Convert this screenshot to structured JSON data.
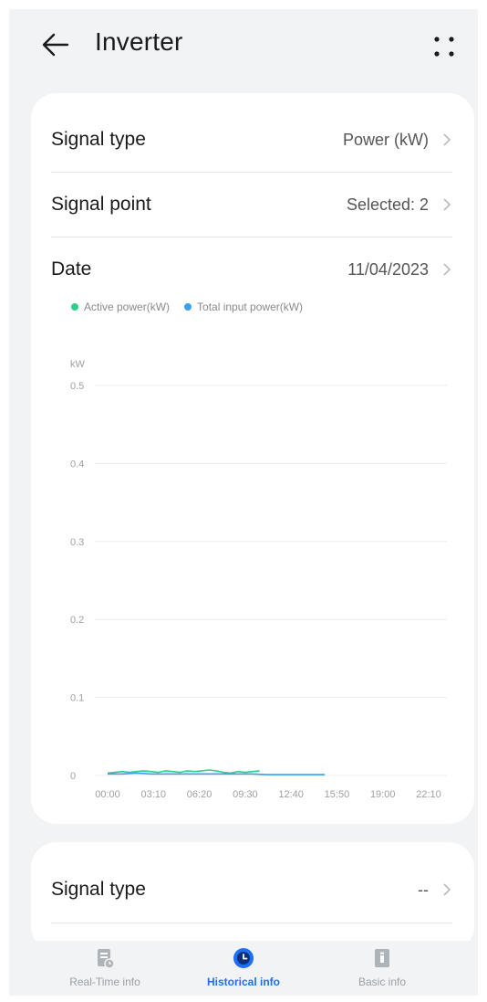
{
  "header": {
    "title": "Inverter",
    "back_icon": "arrow-left-icon",
    "more_icon": "more-dots-icon"
  },
  "settings": [
    {
      "label": "Signal type",
      "value": "Power (kW)"
    },
    {
      "label": "Signal point",
      "value": "Selected: 2"
    },
    {
      "label": "Date",
      "value": "11/04/2023"
    }
  ],
  "chart_data": {
    "type": "line",
    "ylabel": "kW",
    "ylim": [
      0,
      0.5
    ],
    "yticks": [
      "0.5",
      "0.4",
      "0.3",
      "0.2",
      "0.1",
      "0"
    ],
    "x": [
      "00:00",
      "03:10",
      "06:20",
      "09:30",
      "12:40",
      "15:50",
      "19:00",
      "22:10"
    ],
    "legend": [
      {
        "name": "Active power(kW)",
        "color": "#2ecf8b"
      },
      {
        "name": "Total input power(kW)",
        "color": "#3aa0f0"
      }
    ],
    "series": [
      {
        "name": "Active power(kW)",
        "color": "#2ecf8b",
        "points": [
          [
            0.0,
            0.003
          ],
          [
            0.5,
            0.004
          ],
          [
            1.0,
            0.005
          ],
          [
            1.5,
            0.004
          ],
          [
            2.0,
            0.005
          ],
          [
            2.5,
            0.006
          ],
          [
            3.0,
            0.005
          ],
          [
            3.5,
            0.004
          ],
          [
            4.0,
            0.006
          ],
          [
            4.5,
            0.005
          ],
          [
            5.0,
            0.004
          ],
          [
            5.5,
            0.006
          ],
          [
            6.0,
            0.005
          ],
          [
            6.5,
            0.006
          ],
          [
            7.0,
            0.007
          ],
          [
            7.5,
            0.006
          ],
          [
            8.0,
            0.004
          ],
          [
            8.5,
            0.003
          ],
          [
            9.0,
            0.005
          ],
          [
            9.5,
            0.004
          ],
          [
            10.0,
            0.005
          ],
          [
            10.5,
            0.006
          ]
        ]
      },
      {
        "name": "Total input power(kW)",
        "color": "#3aa0f0",
        "points": [
          [
            0.0,
            0.002
          ],
          [
            1.0,
            0.002
          ],
          [
            2.0,
            0.003
          ],
          [
            3.0,
            0.002
          ],
          [
            4.0,
            0.002
          ],
          [
            5.0,
            0.002
          ],
          [
            6.0,
            0.002
          ],
          [
            7.0,
            0.002
          ],
          [
            8.0,
            0.002
          ],
          [
            9.0,
            0.002
          ],
          [
            10.0,
            0.002
          ],
          [
            11.0,
            0.001
          ],
          [
            12.0,
            0.001
          ],
          [
            13.0,
            0.001
          ],
          [
            14.0,
            0.001
          ],
          [
            15.0,
            0.001
          ]
        ]
      }
    ]
  },
  "second_card": {
    "label": "Signal type",
    "value": "--"
  },
  "nav": [
    {
      "label": "Real-Time info",
      "icon": "realtime-info-icon",
      "active": false
    },
    {
      "label": "Historical info",
      "icon": "history-clock-icon",
      "active": true
    },
    {
      "label": "Basic info",
      "icon": "basic-info-icon",
      "active": false
    }
  ],
  "colors": {
    "accent": "#1e6ef5",
    "background": "#f1f3f5",
    "card": "#ffffff"
  }
}
